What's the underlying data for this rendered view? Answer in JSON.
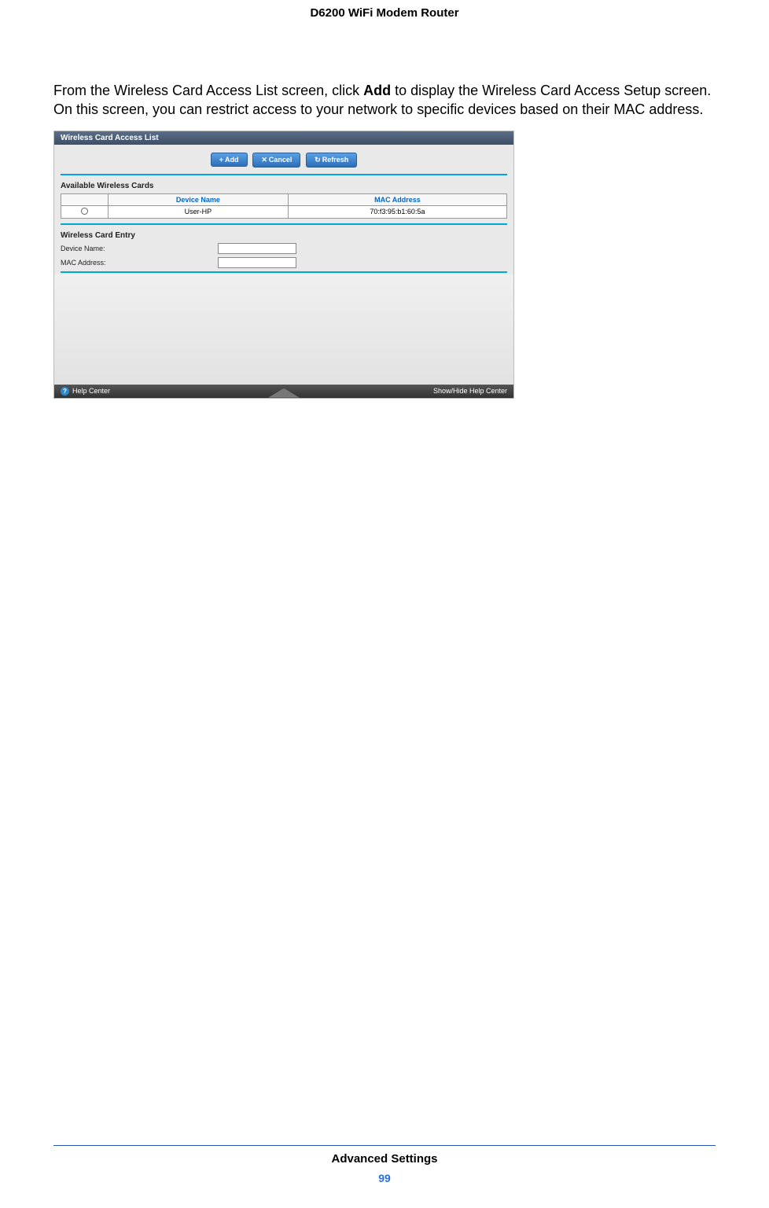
{
  "header": {
    "title": "D6200 WiFi Modem Router"
  },
  "body": {
    "paragraph": {
      "pre": "From the Wireless Card Access List screen, click ",
      "bold": "Add",
      "post": " to display the Wireless Card Access Setup screen. On this screen, you can restrict access to your network to specific devices based on their MAC address."
    }
  },
  "screenshot": {
    "titlebar": "Wireless Card Access List",
    "buttons": {
      "add": "Add",
      "cancel": "Cancel",
      "refresh": "Refresh"
    },
    "available_section": "Available Wireless Cards",
    "table": {
      "headers": {
        "device_name": "Device Name",
        "mac_address": "MAC Address"
      },
      "rows": [
        {
          "device_name": "User-HP",
          "mac_address": "70:f3:95:b1:60:5a"
        }
      ]
    },
    "entry_section": "Wireless Card Entry",
    "entry_labels": {
      "device_name": "Device Name:",
      "mac_address": "MAC Address:"
    },
    "entry_values": {
      "device_name": "",
      "mac_address": ""
    },
    "footer": {
      "help": "Help Center",
      "toggle": "Show/Hide Help Center"
    }
  },
  "footer": {
    "section": "Advanced Settings",
    "page": "99"
  }
}
